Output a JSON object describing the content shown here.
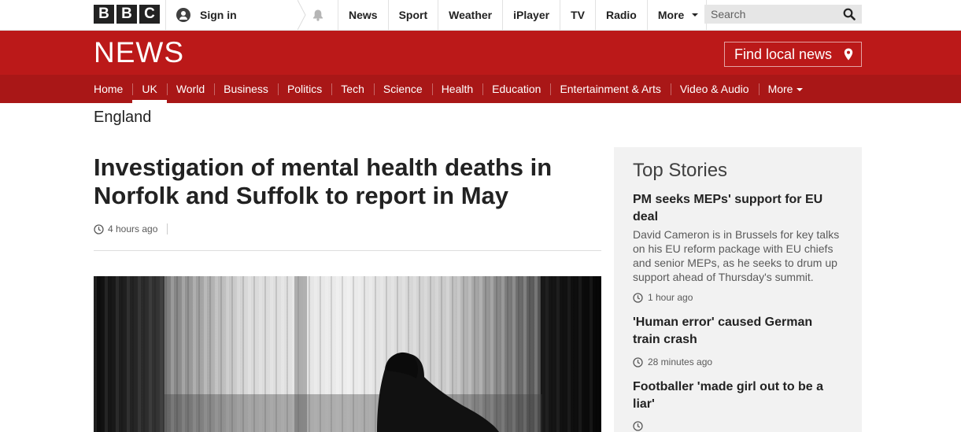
{
  "bbc_logo": [
    "B",
    "B",
    "C"
  ],
  "account": {
    "sign_in_label": "Sign in"
  },
  "top_nav": [
    {
      "label": "News"
    },
    {
      "label": "Sport"
    },
    {
      "label": "Weather"
    },
    {
      "label": "iPlayer"
    },
    {
      "label": "TV"
    },
    {
      "label": "Radio"
    },
    {
      "label": "More"
    }
  ],
  "search": {
    "placeholder": "Search"
  },
  "masthead": {
    "logo_text": "NEWS",
    "find_local_label": "Find local news"
  },
  "section_nav": [
    {
      "label": "Home",
      "active": false
    },
    {
      "label": "UK",
      "active": true
    },
    {
      "label": "World",
      "active": false
    },
    {
      "label": "Business",
      "active": false
    },
    {
      "label": "Politics",
      "active": false
    },
    {
      "label": "Tech",
      "active": false
    },
    {
      "label": "Science",
      "active": false
    },
    {
      "label": "Health",
      "active": false
    },
    {
      "label": "Education",
      "active": false
    },
    {
      "label": "Entertainment & Arts",
      "active": false
    },
    {
      "label": "Video & Audio",
      "active": false
    },
    {
      "label": "More",
      "active": false
    }
  ],
  "section_title": "England",
  "article": {
    "headline": "Investigation of mental health deaths in Norfolk and Suffolk to report in May",
    "timestamp": "4 hours ago"
  },
  "top_stories": {
    "title": "Top Stories",
    "items": [
      {
        "headline": "PM seeks MEPs' support for EU deal",
        "summary": "David Cameron is in Brussels for key talks on his EU reform package with EU chiefs and senior MEPs, as he seeks to drum up support ahead of Thursday's summit.",
        "time": "1 hour ago"
      },
      {
        "headline": "'Human error' caused German train crash",
        "summary": "",
        "time": "28 minutes ago"
      },
      {
        "headline": "Footballer 'made girl out to be a liar'",
        "summary": "",
        "time": ""
      }
    ]
  },
  "colors": {
    "brand_red": "#bb1919",
    "nav_red": "#a91717",
    "text_dark": "#222222",
    "text_meta": "#5a5a5a",
    "panel_bg": "#f2f2f2"
  }
}
